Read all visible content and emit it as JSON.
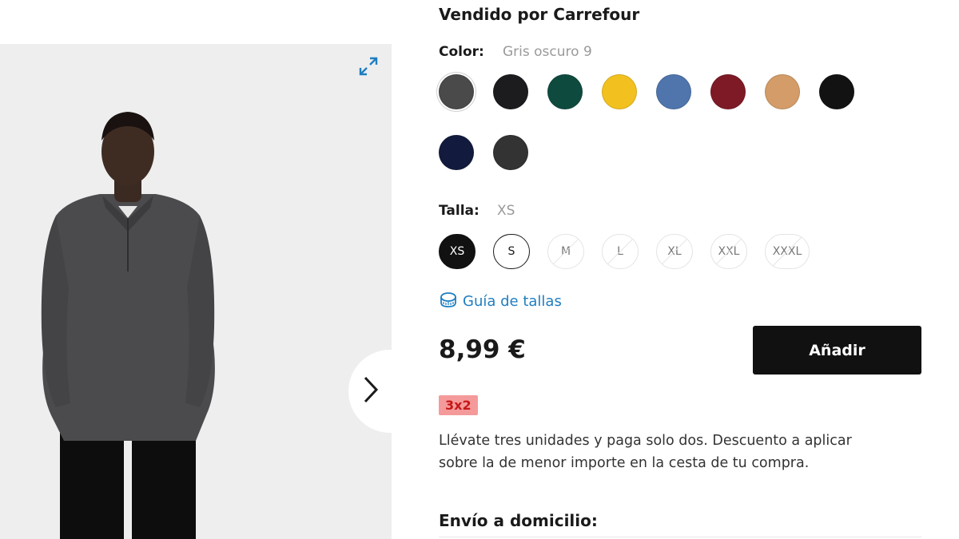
{
  "seller": {
    "text": "Vendido por Carrefour"
  },
  "color": {
    "label": "Color:",
    "selected": "Gris oscuro 9",
    "swatches": [
      {
        "hex": "#4a4a4a",
        "selected": true
      },
      {
        "hex": "#1c1c1f",
        "selected": false
      },
      {
        "hex": "#0f4a3f",
        "selected": false
      },
      {
        "hex": "#f2c11f",
        "selected": false
      },
      {
        "hex": "#4f75ac",
        "selected": false
      },
      {
        "hex": "#7e1a26",
        "selected": false
      },
      {
        "hex": "#d39c68",
        "selected": false
      },
      {
        "hex": "#121212",
        "selected": false
      },
      {
        "hex": "#121b3d",
        "selected": false
      },
      {
        "hex": "#333333",
        "selected": false
      }
    ]
  },
  "size": {
    "label": "Talla:",
    "selected": "XS",
    "options": [
      {
        "label": "XS",
        "state": "active"
      },
      {
        "label": "S",
        "state": "available"
      },
      {
        "label": "M",
        "state": "disabled"
      },
      {
        "label": "L",
        "state": "disabled"
      },
      {
        "label": "XL",
        "state": "disabled"
      },
      {
        "label": "XXL",
        "state": "disabled"
      },
      {
        "label": "XXXL",
        "state": "disabled"
      }
    ]
  },
  "size_guide": {
    "label": "Guía de tallas",
    "icon": "measuring-tape-icon"
  },
  "price": {
    "text": "8,99 €"
  },
  "add_button": {
    "label": "Añadir"
  },
  "promo": {
    "badge": "3x2",
    "description": "Llévate tres unidades y paga solo dos. Descuento a aplicar sobre la de menor importe en la cesta de tu compra."
  },
  "shipping": {
    "label": "Envío a domicilio:"
  },
  "gallery": {
    "expand_icon": "expand-arrows-icon",
    "next_icon": "chevron-right-icon"
  },
  "colors": {
    "link": "#1f7ec0",
    "badge_bg": "#f59a9a",
    "badge_text": "#c61818",
    "button": "#111111"
  }
}
